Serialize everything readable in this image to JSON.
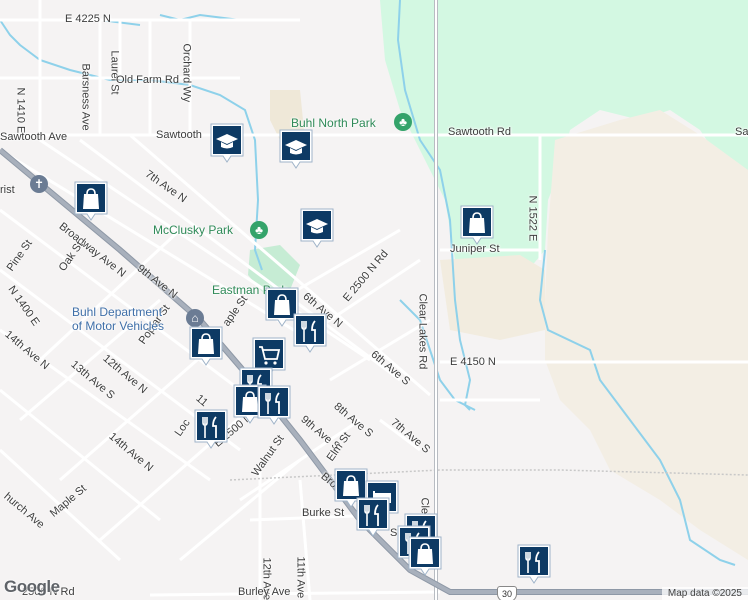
{
  "map": {
    "street_labels": [
      {
        "text": "E 4225 N",
        "rot": 0
      },
      {
        "text": "N 1410 E",
        "rot": 90
      },
      {
        "text": "Laurel St",
        "rot": 90
      },
      {
        "text": "Barsness Ave",
        "rot": 90
      },
      {
        "text": "Orchard Wy",
        "rot": 90
      },
      {
        "text": "Old Farm Rd",
        "rot": 0
      },
      {
        "text": "Sawtooth Ave",
        "rot": 0
      },
      {
        "text": "Sawtooth",
        "rot": 0
      },
      {
        "text": "Sawtooth Rd",
        "rot": 0
      },
      {
        "text": "Sa",
        "rot": 0
      },
      {
        "text": "N 1522 E",
        "rot": 90
      },
      {
        "text": "7th Ave N",
        "rot": 35
      },
      {
        "text": "Broadway Ave N",
        "rot": 38
      },
      {
        "text": "9th Ave N",
        "rot": 38
      },
      {
        "text": "Oak St",
        "rot": -55
      },
      {
        "text": "Pine St",
        "rot": -55
      },
      {
        "text": "N 1400 E",
        "rot": 55
      },
      {
        "text": "Juniper St",
        "rot": 0
      },
      {
        "text": "Clear Lakes Rd",
        "rot": 90
      },
      {
        "text": "6th Ave N",
        "rot": 40
      },
      {
        "text": "E 2500 N Rd",
        "rot": -50
      },
      {
        "text": "6th Ave S",
        "rot": 40
      },
      {
        "text": "E 4150 N",
        "rot": 0
      },
      {
        "text": "Poplar St",
        "rot": -55
      },
      {
        "text": "12th Ave N",
        "rot": 40
      },
      {
        "text": "14th Ave N",
        "rot": 40
      },
      {
        "text": "13th Ave S",
        "rot": 40
      },
      {
        "text": "14th Ave N",
        "rot": 40
      },
      {
        "text": "aple St",
        "rot": -55
      },
      {
        "text": "8th Ave S",
        "rot": 40
      },
      {
        "text": "7th Ave S",
        "rot": 40
      },
      {
        "text": "9th Ave S",
        "rot": 40
      },
      {
        "text": "Elm St",
        "rot": -55
      },
      {
        "text": "E 2500 N Rd",
        "rot": -40
      },
      {
        "text": "Walnut St",
        "rot": -55
      },
      {
        "text": "Loc",
        "rot": -55
      },
      {
        "text": "11",
        "rot": 40
      },
      {
        "text": "Maple St",
        "rot": -40
      },
      {
        "text": "hurch Ave",
        "rot": 40
      },
      {
        "text": "Burke St",
        "rot": 0
      },
      {
        "text": "12th Ave S",
        "rot": 90
      },
      {
        "text": "11th Ave S",
        "rot": 90
      },
      {
        "text": "Burley Ave",
        "rot": 0
      },
      {
        "text": "2500 N Rd",
        "rot": 0
      },
      {
        "text": "Bro",
        "rot": 40
      },
      {
        "text": "Clea",
        "rot": 90
      },
      {
        "text": "S",
        "rot": 0
      },
      {
        "text": "rist",
        "rot": 0
      }
    ],
    "park_labels": [
      "Buhl North Park",
      "McClusky Park",
      "Eastman Park"
    ],
    "poi_labels": [
      "Buhl Department",
      "of Motor Vehicles"
    ],
    "route_shield": "30",
    "markers": [
      {
        "type": "school",
        "icon": "graduation-cap-icon"
      },
      {
        "type": "school",
        "icon": "graduation-cap-icon"
      },
      {
        "type": "school",
        "icon": "graduation-cap-icon"
      },
      {
        "type": "shopping",
        "icon": "shopping-bag-icon"
      },
      {
        "type": "shopping",
        "icon": "shopping-bag-icon"
      },
      {
        "type": "shopping",
        "icon": "shopping-bag-icon"
      },
      {
        "type": "shopping",
        "icon": "shopping-bag-icon"
      },
      {
        "type": "restaurant",
        "icon": "fork-knife-icon"
      },
      {
        "type": "grocery",
        "icon": "shopping-cart-icon"
      },
      {
        "type": "restaurant",
        "icon": "fork-knife-icon"
      },
      {
        "type": "shopping",
        "icon": "shopping-bag-icon"
      },
      {
        "type": "restaurant",
        "icon": "fork-knife-icon"
      },
      {
        "type": "restaurant",
        "icon": "fork-knife-icon"
      },
      {
        "type": "shopping",
        "icon": "shopping-bag-icon"
      },
      {
        "type": "hospital",
        "icon": "bed-icon"
      },
      {
        "type": "restaurant",
        "icon": "fork-knife-icon"
      },
      {
        "type": "restaurant",
        "icon": "fork-knife-icon"
      },
      {
        "type": "restaurant",
        "icon": "fork-knife-icon"
      },
      {
        "type": "shopping",
        "icon": "shopping-bag-icon"
      },
      {
        "type": "restaurant",
        "icon": "fork-knife-icon"
      }
    ],
    "attribution": "Map data ©2025",
    "logo": "Google",
    "colors": {
      "background": "#f5f3f3",
      "forest": "#d3f8e2",
      "agriculture": "#f3eee4",
      "park": "#c6ecd4",
      "water": "#8ed1ea",
      "highway": "#9aa4b2",
      "road": "#ffffff",
      "marker": "#0d3a64"
    }
  }
}
